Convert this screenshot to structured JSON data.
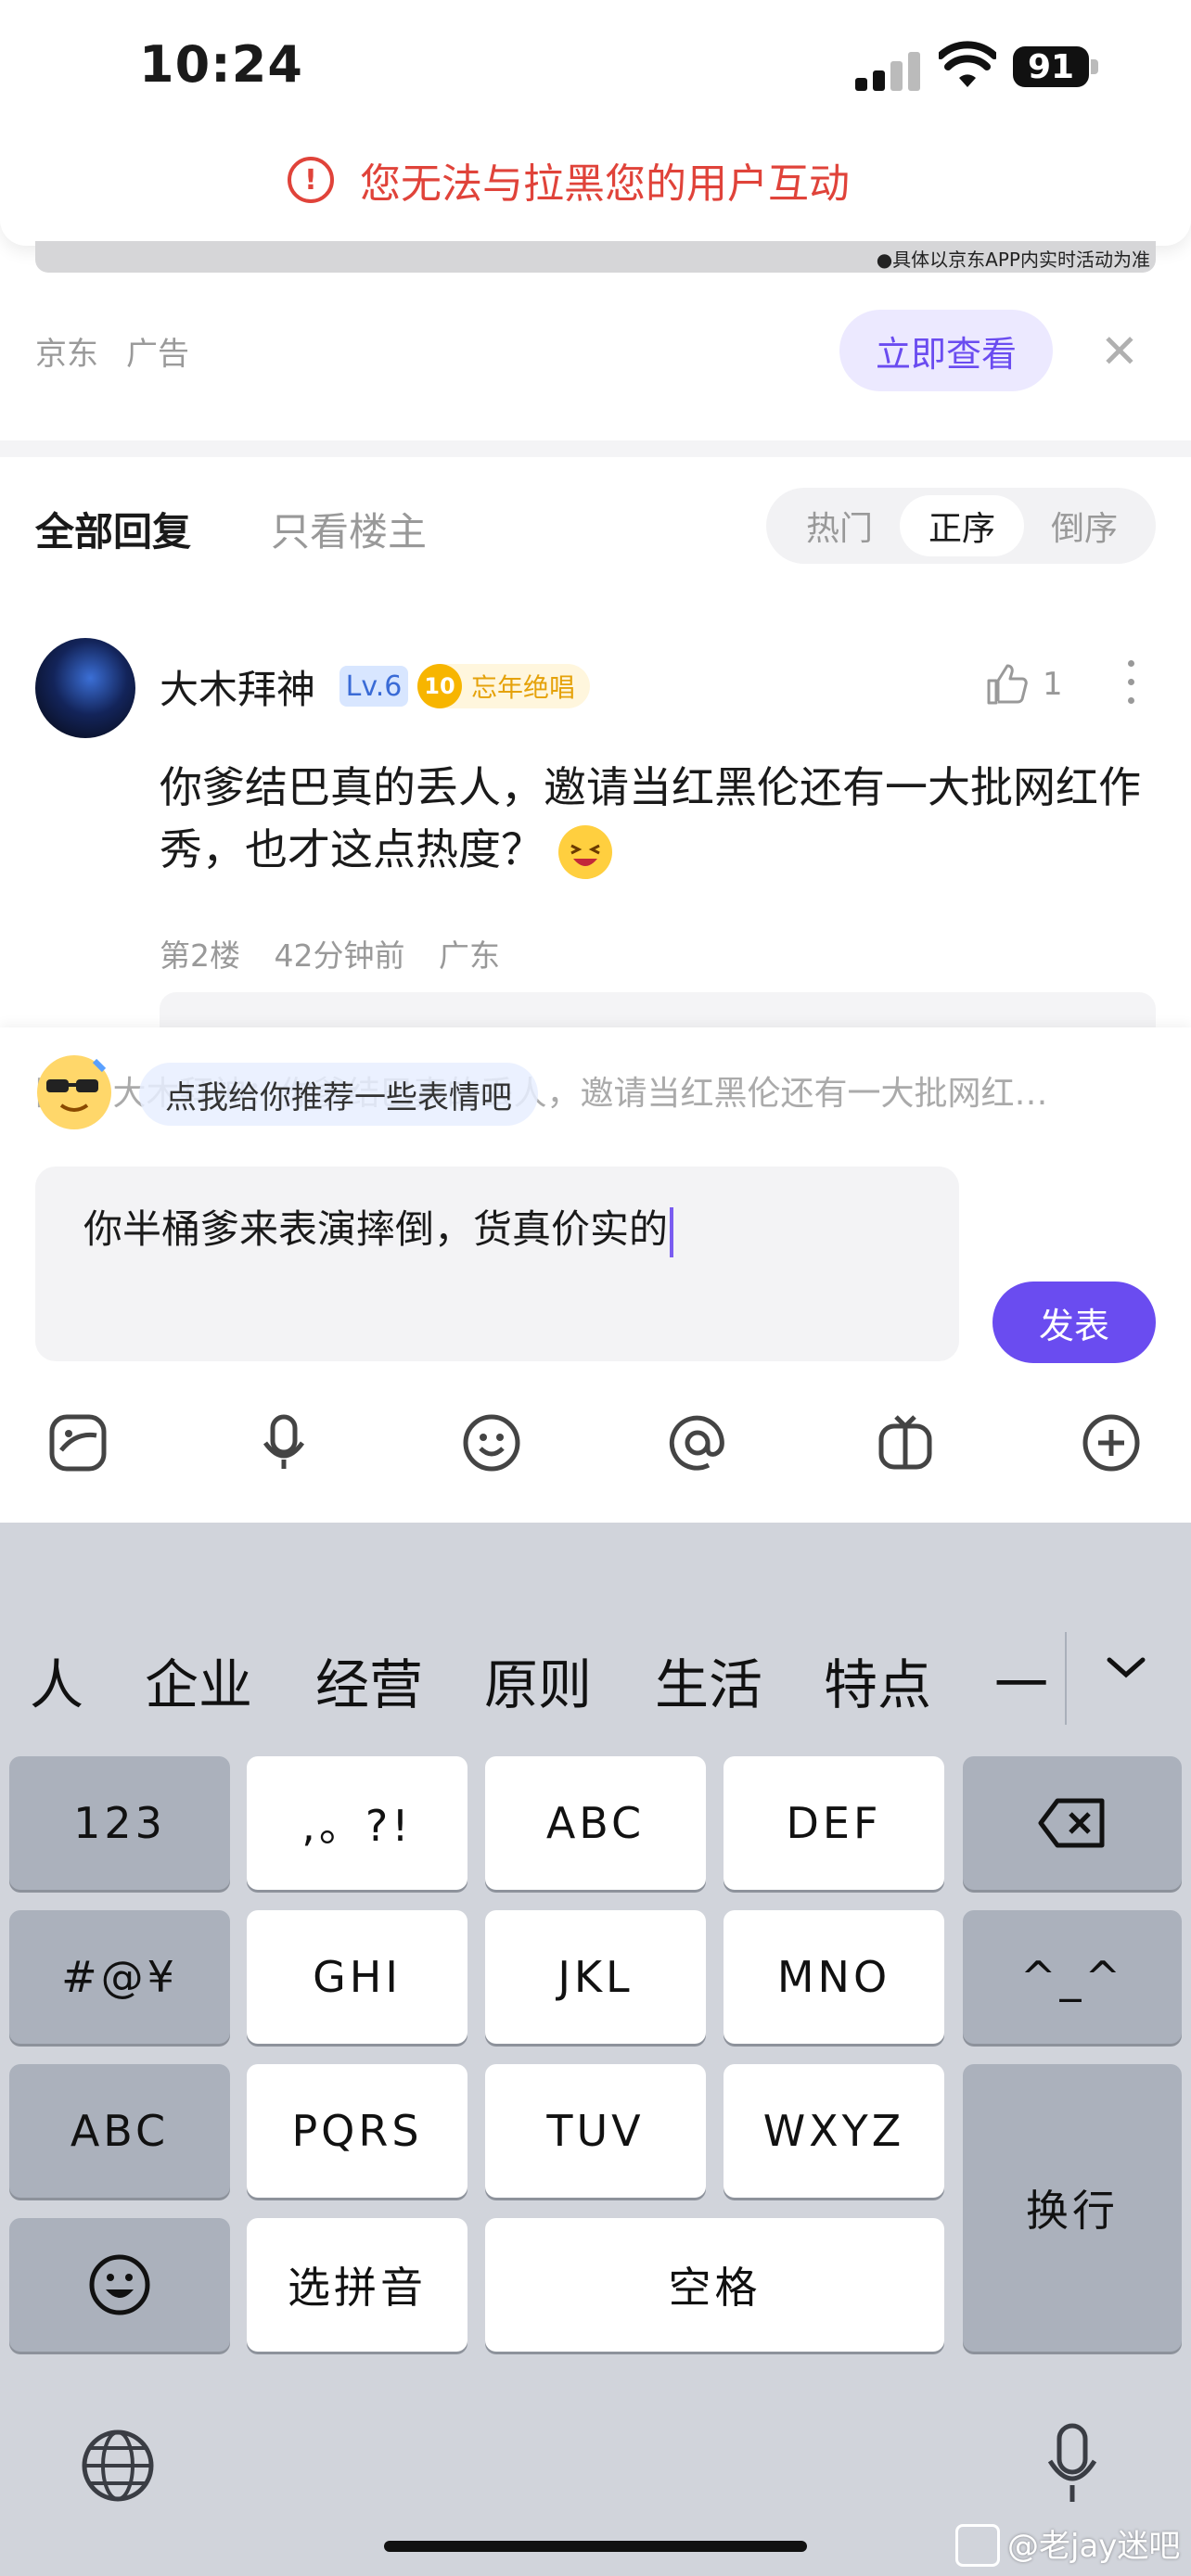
{
  "status_bar": {
    "time": "10:24",
    "battery": "91"
  },
  "alert": {
    "message": "您无法与拉黑您的用户互动",
    "icon": "exclamation-circle-icon",
    "color": "#e0433a"
  },
  "ad": {
    "strip_text": "●具体以京东APP内实时活动为准",
    "source": "京东",
    "tag": "广告",
    "cta_label": "立即查看",
    "close_icon": "close-icon"
  },
  "tabs": {
    "all": "全部回复",
    "host_only": "只看楼主",
    "sort": [
      "热门",
      "正序",
      "倒序"
    ],
    "active_sort": "正序"
  },
  "comment": {
    "username": "大木拜神",
    "level": "Lv.6",
    "badge_num": "10",
    "badge_text": "忘年绝唱",
    "likes": "1",
    "text": "你爹结巴真的丢人，邀请当红黑伦还有一大批网红作秀，也才这点热度？",
    "floor": "第2楼",
    "time": "42分钟前",
    "location": "广东"
  },
  "composer": {
    "reply_line": "回复 大木拜神：你爹结巴真的丢人，邀请当红黑伦还有一大批网红…",
    "suggest": "点我给你推荐一些表情吧",
    "input_value": "你半桶爹来表演摔倒，货真价实的",
    "send_label": "发表",
    "accent": "#6a4cf0",
    "tool_icons": [
      "sticker-icon",
      "microphone-icon",
      "smiley-icon",
      "at-icon",
      "gift-icon",
      "plus-circle-icon"
    ]
  },
  "keyboard": {
    "candidates": [
      "人",
      "企业",
      "经营",
      "原则",
      "生活",
      "特点",
      "一"
    ],
    "rows": {
      "r1": [
        "123",
        ",。?!",
        "ABC",
        "DEF"
      ],
      "r2": [
        "#@¥",
        "GHI",
        "JKL",
        "MNO",
        "^_^"
      ],
      "r3": [
        "ABC",
        "PQRS",
        "TUV",
        "WXYZ"
      ],
      "r4": [
        "选拼音",
        "空格"
      ],
      "enter": "换行"
    }
  },
  "watermark": "@老jay迷吧"
}
